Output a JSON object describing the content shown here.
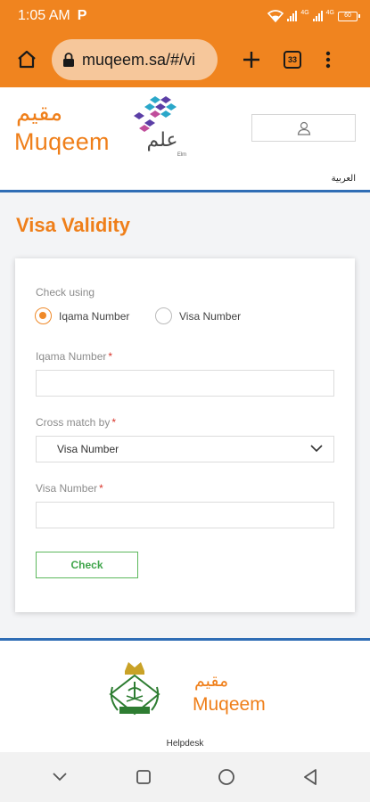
{
  "status_bar": {
    "time": "1:05 AM",
    "carrier_glyph": "P",
    "battery_level": "60",
    "network_labels": [
      "4G",
      "4G"
    ],
    "icons": [
      "wifi-icon",
      "signal-icon",
      "signal-icon",
      "battery-icon"
    ]
  },
  "browser": {
    "url": "muqeem.sa/#/vi",
    "tab_count": "33",
    "icons": [
      "home-icon",
      "lock-icon",
      "plus-icon",
      "tabs-icon",
      "more-vert-icon"
    ]
  },
  "header": {
    "logo_arabic": "مقيم",
    "logo_english": "Muqeem",
    "elm_arabic": "علم",
    "elm_english": "Elm",
    "user_icon": "user-icon",
    "language_link": "العربية"
  },
  "page": {
    "title": "Visa Validity"
  },
  "form": {
    "check_using_label": "Check using",
    "radio_options": [
      {
        "label": "Iqama Number",
        "selected": true
      },
      {
        "label": "Visa Number",
        "selected": false
      }
    ],
    "iqama_label": "Iqama Number",
    "iqama_value": "",
    "cross_match_label": "Cross match by",
    "cross_match_selected": "Visa Number",
    "visa_label": "Visa Number",
    "visa_value": "",
    "required_mark": "*",
    "check_button": "Check"
  },
  "footer": {
    "logo_arabic": "مقيم",
    "logo_english": "Muqeem",
    "helpdesk": "Helpdesk"
  },
  "nav_bar": {
    "icons": [
      "chevron-down-icon",
      "square-icon",
      "circle-icon",
      "back-triangle-icon"
    ]
  },
  "colors": {
    "brand_orange": "#f0841f",
    "accent_blue": "#2f6db5",
    "button_green": "#5cb85c",
    "required_red": "#d9342b"
  }
}
